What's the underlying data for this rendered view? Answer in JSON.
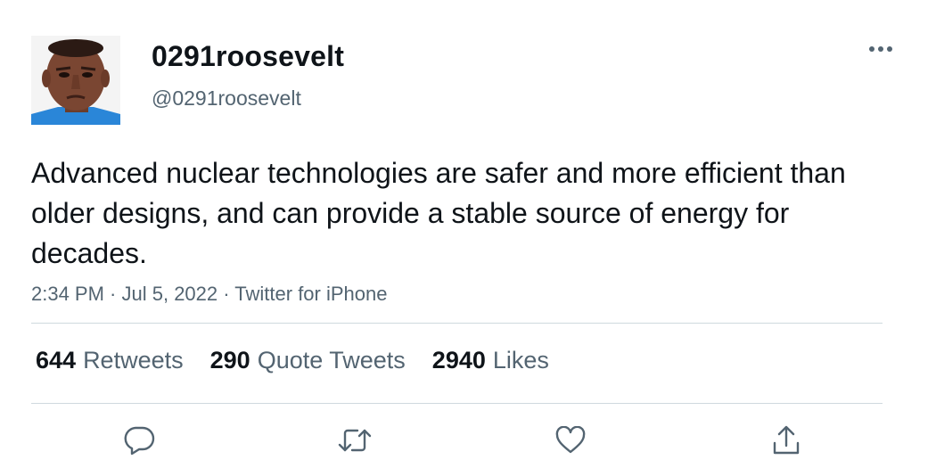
{
  "user": {
    "display_name": "0291roosevelt",
    "handle": "@0291roosevelt",
    "avatar_icon": "profile-photo"
  },
  "tweet": {
    "text": "Advanced nuclear technologies are safer and more efficient than older designs, and can provide a stable source of energy for decades.",
    "time": "2:34 PM",
    "date": "Jul 5, 2022",
    "source": "Twitter for iPhone",
    "separator": " · "
  },
  "stats": {
    "retweets_count": "644",
    "retweets_label": "Retweets",
    "quotes_count": "290",
    "quotes_label": "Quote Tweets",
    "likes_count": "2940",
    "likes_label": "Likes"
  },
  "icons": {
    "more": "more-horizontal-icon",
    "reply": "reply-icon",
    "retweet": "retweet-icon",
    "like": "heart-icon",
    "share": "share-icon"
  },
  "colors": {
    "text": "#0f1419",
    "secondary": "#536471",
    "divider": "#cfd9de"
  }
}
